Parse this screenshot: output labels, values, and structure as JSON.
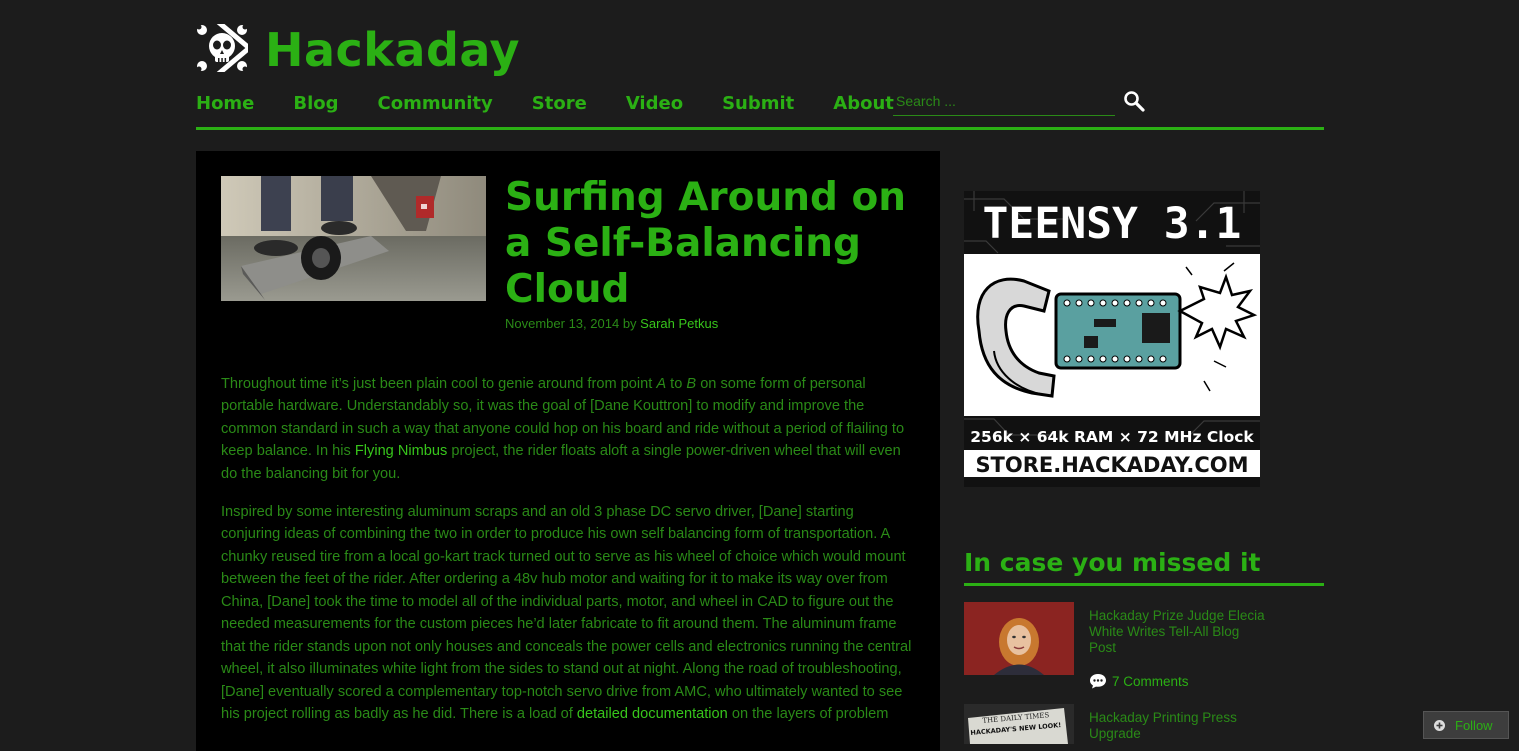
{
  "site": {
    "title": "Hackaday",
    "accent": "#2bb014",
    "logo_icon": "skull-wrenches-icon"
  },
  "nav": {
    "items": [
      "Home",
      "Blog",
      "Community",
      "Store",
      "Video",
      "Submit",
      "About"
    ]
  },
  "search": {
    "placeholder": "Search ...",
    "button_icon": "magnifier-icon"
  },
  "article": {
    "title": "Surfing Around on a Self-Balancing Cloud",
    "date": "November 13, 2014",
    "by": "by",
    "author": "Sarah Petkus",
    "para1": {
      "t1": "Throughout time it’s just been plain cool to genie around from point ",
      "a": "A",
      "t2": " to ",
      "b": "B",
      "t3": " on some form of personal portable hardware. Understandably so, it was the goal of [Dane Kouttron] to modify and improve the common standard in such a way that anyone could hop on his board and ride without a period of flailing to keep balance. In his ",
      "link": "Flying Nimbus",
      "t4": " project, the rider floats aloft a single power-driven wheel that will even do the balancing bit for you."
    },
    "para2": {
      "t1": "Inspired by some interesting aluminum scraps and an old 3 phase DC servo driver, [Dane] starting conjuring ideas of combining the two in order to produce his own self balancing form of transportation. A chunky reused tire from a local go-kart track turned out to serve as his wheel of choice which would mount between the feet of the rider. After ordering a 48v hub motor and waiting for it to make its way over from China, [Dane] took the time to model all of the individual parts, motor, and wheel in CAD to figure out the needed measurements for the custom pieces he’d later fabricate to fit around them. The aluminum frame that the rider stands upon not only houses and conceals the power cells and electronics running the central wheel, it also illuminates white light from the sides to stand out at night. Along the road of troubleshooting, [Dane] eventually scored a complementary top-notch servo drive from AMC, who ultimately wanted to see his project rolling as badly as he did. There is a load of ",
      "link": "detailed documentation",
      "t2": " on the layers of problem"
    }
  },
  "ad": {
    "headline": "TEENSY 3.1",
    "specs": "256k × 64k RAM × 72 MHz Clock",
    "url": "STORE.HACKADAY.COM"
  },
  "sidebar": {
    "heading": "In case you missed it",
    "posts": [
      {
        "title": "Hackaday Prize Judge Elecia White Writes Tell-All Blog Post",
        "comments": "7 Comments"
      },
      {
        "title": "Hackaday Printing Press Upgrade",
        "thumb_text": "THE DAILY TIMES",
        "thumb_text2": "HACKADAY'S NEW LOOK!"
      }
    ]
  },
  "follow": {
    "label": "Follow",
    "icon": "plus-circle-icon"
  }
}
